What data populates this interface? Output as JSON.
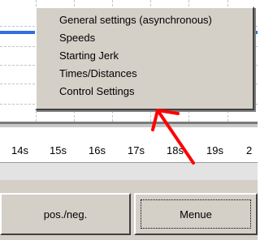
{
  "menu": {
    "items": [
      {
        "label": "General settings (asynchronous)"
      },
      {
        "label": "Speeds"
      },
      {
        "label": "Starting Jerk"
      },
      {
        "label": "Times/Distances"
      },
      {
        "label": "Control Settings"
      }
    ]
  },
  "axis": {
    "ticks": [
      "14s",
      "15s",
      "16s",
      "17s",
      "18s",
      "19s",
      "2"
    ]
  },
  "buttons": {
    "pos_neg_label": "pos./neg.",
    "menue_label": "Menue"
  },
  "annotation": {
    "arrow_color": "#ff0000",
    "target": "Control Settings"
  },
  "colors": {
    "chart_line": "#2f6fe0",
    "window_face": "#d4d0c8"
  }
}
